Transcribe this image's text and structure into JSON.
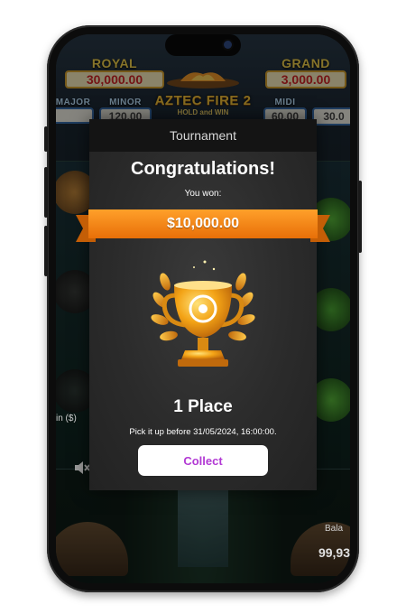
{
  "game": {
    "jackpots": {
      "royal": {
        "label": "ROYAL",
        "value": "30,000.00"
      },
      "grand": {
        "label": "GRAND",
        "value": "3,000.00"
      },
      "major": {
        "label": "MAJOR",
        "value": ""
      },
      "minor": {
        "label": "MINOR",
        "value": "120.00"
      },
      "midi": {
        "label": "MIDI",
        "value": "60.00"
      },
      "mini": {
        "label": "",
        "value": "30.0"
      }
    },
    "logo": "AZTEC FIRE 2",
    "logo_sub": "HOLD and WIN",
    "bet_label": "in ($)",
    "balance_label": "Bala",
    "balance_value": "99,93"
  },
  "dialog": {
    "header": "Tournament",
    "congrats": "Congratulations!",
    "you_won": "You won:",
    "prize": "$10,000.00",
    "place": "1 Place",
    "deadline": "Pick it up before 31/05/2024, 16:00:00.",
    "collect_label": "Collect"
  },
  "colors": {
    "ribbon": "#f28a12",
    "ribbon_dark": "#c45e06",
    "collect_text": "#b23ad4",
    "trophy_gold": "#f3a316"
  },
  "icons": {
    "mute": "speaker-mute-icon",
    "trophy": "trophy-icon"
  }
}
